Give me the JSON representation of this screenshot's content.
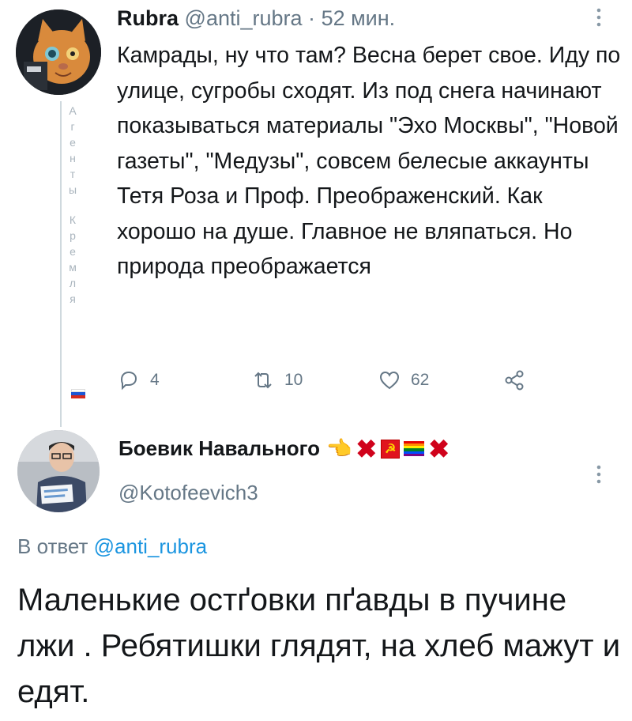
{
  "tweet1": {
    "display_name": "Rubra",
    "handle": "@anti_rubra",
    "separator": "·",
    "time": "52 мин.",
    "text": "Камрады, ну что там? Весна берет свое. Иду по улице, сугробы сходят. Из под снега начинают показываться материалы \"Эхо Москвы\", \"Новой газеты\", \"Медузы\", совсем белесые аккаунты Тетя Роза и Проф. Преображенский. Как хорошо на душе. Главное не вляпаться. Но природа преображается",
    "side_caption_letters_1": [
      "А",
      "г",
      "е",
      "н",
      "т",
      "ы"
    ],
    "side_caption_letters_2": [
      "К",
      "р",
      "е",
      "м",
      "л",
      "я"
    ],
    "avatar_icon": "cat-avatar-icon",
    "actions": {
      "reply_count": "4",
      "retweet_count": "10",
      "like_count": "62"
    },
    "flag": {
      "colors": [
        "#ffffff",
        "#1c57d6",
        "#d52b1e"
      ]
    }
  },
  "tweet2": {
    "display_name": "Боевик Навального",
    "handle": "@Kotofeevich3",
    "reply_prefix": "В ответ",
    "reply_handle": "@anti_rubra",
    "text": "Маленькие остґовки пґавды в пучине лжи . Ребятишки глядят, на хлеб мажут и едят.",
    "emoji_names": [
      "point-left-hand-emoji",
      "cross-mark-emoji",
      "hammer-sickle-emoji",
      "rainbow-flag-emoji",
      "cross-mark-emoji"
    ],
    "emoji_glyphs": {
      "hand": "👈",
      "x": "✖",
      "hammer": "☭"
    },
    "rainbow_colors": [
      "#e40303",
      "#ff8c00",
      "#ffed00",
      "#008026",
      "#004dff",
      "#750787"
    ]
  },
  "colors": {
    "muted": "#657786",
    "link": "#1b95e0",
    "text": "#14171a",
    "thread_line": "#cfd9de"
  }
}
